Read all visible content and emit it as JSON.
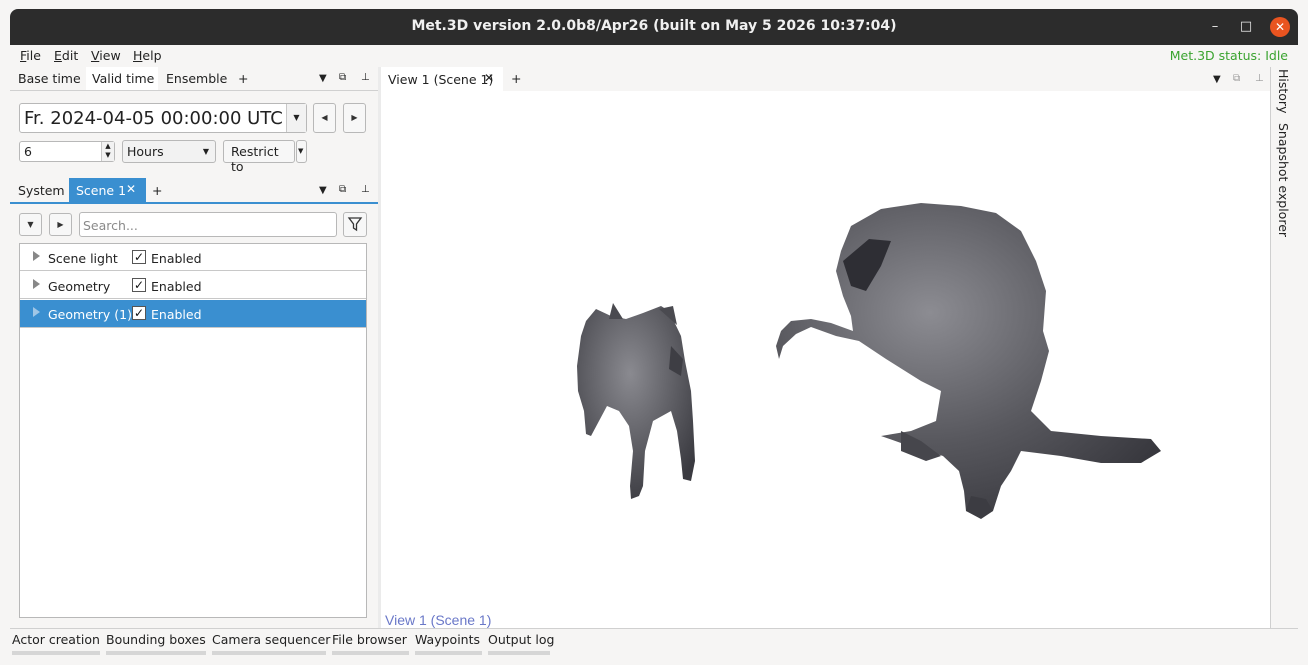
{
  "window": {
    "title": "Met.3D version 2.0.0b8/Apr26 (built on May  5 2026 10:37:04)",
    "minimize_glyph": "–",
    "maximize_glyph": "□",
    "close_glyph": "✕"
  },
  "menubar": {
    "items": [
      {
        "label": "File",
        "mnemonic": "F",
        "rest": "ile"
      },
      {
        "label": "Edit",
        "mnemonic": "E",
        "rest": "dit"
      },
      {
        "label": "View",
        "mnemonic": "V",
        "rest": "iew"
      },
      {
        "label": "Help",
        "mnemonic": "H",
        "rest": "elp"
      }
    ],
    "status": "Met.3D status: Idle"
  },
  "time_dock": {
    "tabs": [
      "Base time",
      "Valid time",
      "Ensemble"
    ],
    "active_tab": "Valid time",
    "add_label": "+",
    "datetime_value": "Fr. 2024-04-05 00:00:00 UTC",
    "step_value": "6",
    "step_unit": "Hours",
    "restrict_label": "Restrict to"
  },
  "scene_dock": {
    "tabs": [
      "System",
      "Scene 1"
    ],
    "active_tab": "Scene 1",
    "add_label": "+",
    "search_placeholder": "Search...",
    "rows": [
      {
        "label": "Scene light",
        "checked": true,
        "state": "Enabled",
        "selected": false
      },
      {
        "label": "Geometry",
        "checked": true,
        "state": "Enabled",
        "selected": false
      },
      {
        "label": "Geometry (1)",
        "checked": true,
        "state": "Enabled",
        "selected": true
      }
    ]
  },
  "view_tabs": {
    "active_tab": "View 1 (Scene 1)",
    "add_label": "+",
    "viewport_label": "View 1 (Scene 1)"
  },
  "right_docks": [
    "History",
    "Snapshot explorer"
  ],
  "bottom_tabs": [
    "Actor creation",
    "Bounding boxes",
    "Camera sequencer",
    "File browser",
    "Waypoints",
    "Output log"
  ],
  "colors": {
    "selection": "#3a8fd0",
    "status": "#3aa32f",
    "close_button": "#e95420",
    "mesh": "#5a5a5e"
  }
}
